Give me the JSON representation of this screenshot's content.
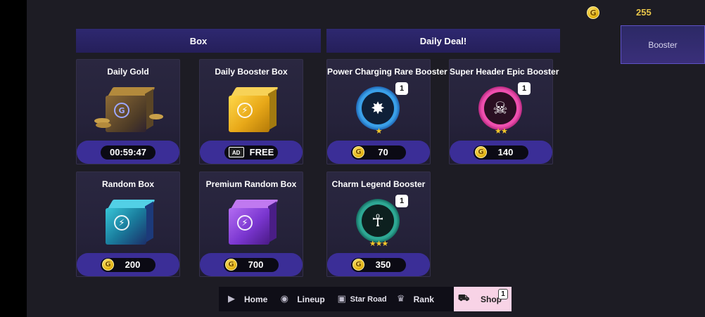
{
  "currency": {
    "icon": "gold-coin-icon",
    "coin_letter": "G",
    "amount": "255"
  },
  "side_tab": {
    "label": "Booster"
  },
  "sections": {
    "box": "Box",
    "daily_deal": "Daily Deal!"
  },
  "box_items": [
    {
      "title": "Daily Gold",
      "footer_type": "timer",
      "footer": "00:59:47",
      "art": "gold-box-icon"
    },
    {
      "title": "Daily Booster Box",
      "footer_type": "ad",
      "ad_label": "AD",
      "footer": "FREE",
      "art": "yellow-booster-box-icon"
    },
    {
      "title": "Random Box",
      "footer_type": "price",
      "price": "200",
      "art": "teal-booster-box-icon"
    },
    {
      "title": "Premium Random Box",
      "footer_type": "price",
      "price": "700",
      "art": "purple-booster-box-icon"
    }
  ],
  "deal_items": [
    {
      "title": "Power Charging Rare Booster",
      "price": "70",
      "badge": "1",
      "stars": "★",
      "art": "power-charging-icon"
    },
    {
      "title": "Super Header Epic Booster",
      "price": "140",
      "badge": "1",
      "stars": "★★",
      "art": "super-header-icon"
    },
    {
      "title": "Charm Legend Booster",
      "price": "350",
      "badge": "1",
      "stars": "★★★",
      "art": "charm-legend-icon"
    }
  ],
  "nav": [
    {
      "label": "Home",
      "icon": "home-icon"
    },
    {
      "label": "Lineup",
      "icon": "lineup-icon"
    },
    {
      "label": "Star Road",
      "icon": "star-road-icon"
    },
    {
      "label": "Rank",
      "icon": "trophy-icon"
    },
    {
      "label": "Shop",
      "icon": "cart-icon",
      "badge": "1",
      "active": true
    }
  ],
  "colors": {
    "accent_purple": "#3b2e97",
    "header": "#2e2870",
    "gold": "#e9c64a",
    "active_tab": "#f8d3e6"
  }
}
